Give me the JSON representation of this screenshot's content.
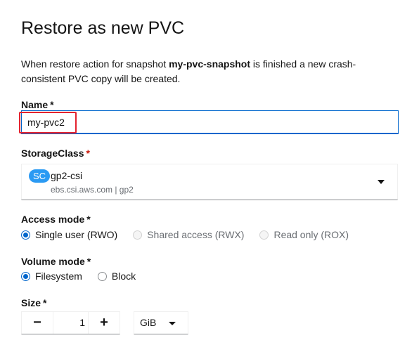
{
  "title": "Restore as new PVC",
  "description": {
    "prefix": "When restore action for snapshot ",
    "snapshot": "my-pvc-snapshot",
    "suffix": " is finished a new crash-consistent PVC copy will be created."
  },
  "name_field": {
    "label": "Name",
    "required": "*",
    "value": "my-pvc2"
  },
  "storage_class": {
    "label": "StorageClass",
    "required": "*",
    "badge": "SC",
    "name": "gp2-csi",
    "sub": "ebs.csi.aws.com | gp2"
  },
  "access_mode": {
    "label": "Access mode",
    "required": "*",
    "options": [
      {
        "label": "Single user (RWO)",
        "checked": true,
        "disabled": false
      },
      {
        "label": "Shared access (RWX)",
        "checked": false,
        "disabled": true
      },
      {
        "label": "Read only (ROX)",
        "checked": false,
        "disabled": true
      }
    ]
  },
  "volume_mode": {
    "label": "Volume mode",
    "required": "*",
    "options": [
      {
        "label": "Filesystem",
        "checked": true
      },
      {
        "label": "Block",
        "checked": false
      }
    ]
  },
  "size": {
    "label": "Size",
    "required": "*",
    "minus": "−",
    "plus": "+",
    "value": "1",
    "unit": "GiB"
  },
  "colors": {
    "accent": "#0066cc",
    "required_red": "#c9190b",
    "highlight": "#e4222e",
    "badge": "#2b9af3"
  }
}
